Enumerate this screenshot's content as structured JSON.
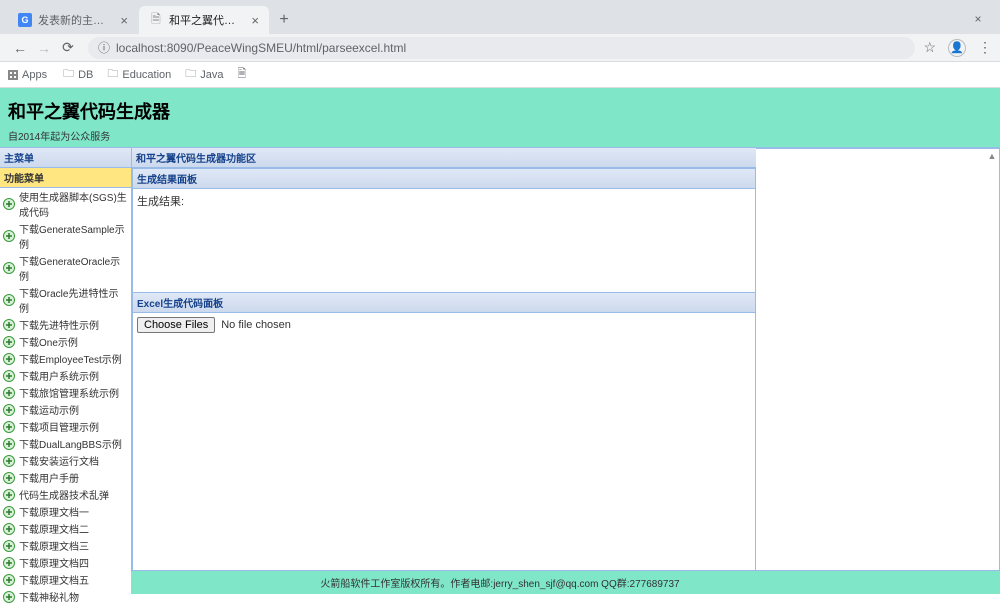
{
  "browser": {
    "tabs": [
      {
        "title": "发表新的主题 - ITeye论坛",
        "favicon": "G"
      },
      {
        "title": "和平之翼代码生成器SME"
      }
    ],
    "url": "localhost:8090/PeaceWingSMEU/html/parseexcel.html",
    "bookmarks": [
      {
        "icon": "folder",
        "label": "DB"
      },
      {
        "icon": "folder",
        "label": "Education"
      },
      {
        "icon": "folder",
        "label": "Java"
      },
      {
        "icon": "doc",
        "label": ""
      }
    ],
    "apps_label": "Apps"
  },
  "page": {
    "title": "和平之翼代码生成器",
    "subtitle": "自2014年起为公众服务"
  },
  "sidebar": {
    "main_menu_label": "主菜单",
    "func_menu_label": "功能菜单",
    "items": [
      "使用生成器脚本(SGS)生成代码",
      "下载GenerateSample示例",
      "下载GenerateOracle示例",
      "下载Oracle先进特性示例",
      "下载先进特性示例",
      "下载One示例",
      "下载EmployeeTest示例",
      "下载用户系统示例",
      "下载旅馆管理系统示例",
      "下载运动示例",
      "下载项目管理示例",
      "下载DualLangBBS示例",
      "下载安装运行文档",
      "下载用户手册",
      "代码生成器技术乱弹",
      "下载原理文档一",
      "下载原理文档二",
      "下载原理文档三",
      "下载原理文档四",
      "下载原理文档五",
      "下载神秘礼物"
    ]
  },
  "main": {
    "region_title": "和平之翼代码生成器功能区",
    "result_panel_title": "生成结果面板",
    "result_label": "生成结果:",
    "excel_panel_title": "Excel生成代码面板",
    "choose_files_btn": "Choose Files",
    "no_file_chosen": "No file chosen"
  },
  "footer": {
    "text": "火箭船软件工作室版权所有。作者电邮:jerry_shen_sjf@qq.com QQ群:277689737"
  }
}
